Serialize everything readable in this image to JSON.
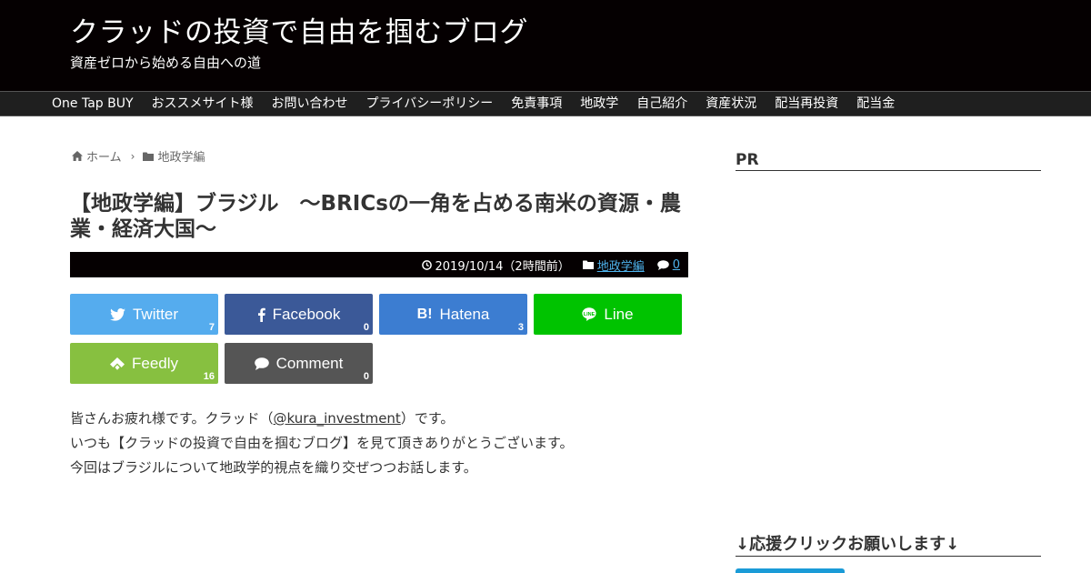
{
  "site": {
    "title": "クラッドの投資で自由を掴むブログ",
    "tagline": "資産ゼロから始める自由への道"
  },
  "nav": {
    "items": [
      {
        "label": "One Tap BUY"
      },
      {
        "label": "おススメサイト様"
      },
      {
        "label": "お問い合わせ"
      },
      {
        "label": "プライバシーポリシー"
      },
      {
        "label": "免責事項"
      },
      {
        "label": "地政学"
      },
      {
        "label": "自己紹介"
      },
      {
        "label": "資産状況"
      },
      {
        "label": "配当再投資"
      },
      {
        "label": "配当金"
      }
    ]
  },
  "breadcrumb": {
    "home": "ホーム",
    "category": "地政学編",
    "icons": [
      "home-icon",
      "chevron-right-icon",
      "folder-icon"
    ]
  },
  "article": {
    "title": "【地政学編】ブラジル　～BRICsの一角を占める南米の資源・農業・経済大国～",
    "date": "2019/10/14（2時間前）",
    "category": "地政学編",
    "comments": "0"
  },
  "share": {
    "twitter": {
      "label": "Twitter",
      "count": "7",
      "icon": "twitter-bird-icon",
      "color": "#55acee"
    },
    "facebook": {
      "label": "Facebook",
      "count": "0",
      "icon": "facebook-f-icon",
      "color": "#3b5998"
    },
    "hatena": {
      "label": "Hatena",
      "count": "3",
      "icon": "hatena-b-icon",
      "color": "#3c7dd1"
    },
    "line": {
      "label": "Line",
      "icon": "line-icon",
      "color": "#00c300"
    },
    "feedly": {
      "label": "Feedly",
      "count": "16",
      "icon": "feedly-icon",
      "color": "#87c040"
    },
    "comment": {
      "label": "Comment",
      "count": "0",
      "icon": "speech-bubble-icon",
      "color": "#555555"
    }
  },
  "body": {
    "line1_prefix": "皆さんお疲れ様です。クラッド（",
    "line1_link": "@kura_investment",
    "line1_suffix": "）です。",
    "line2": "いつも【クラッドの投資で自由を掴むブログ】を見て頂きありがとうございます。",
    "line3": "今回はブラジルについて地政学的視点を織り交ぜつつお話します。"
  },
  "sidebar": {
    "pr_heading": "PR",
    "support_heading": "↓応援クリックお願いします↓"
  },
  "colors": {
    "header_bg": "#050001",
    "nav_bg": "#1f1f1f",
    "link": "#4db2ec"
  }
}
